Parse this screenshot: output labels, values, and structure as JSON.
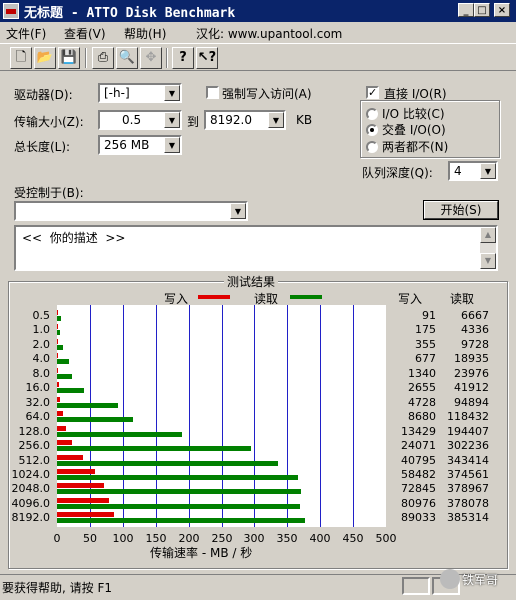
{
  "window": {
    "title": "无标题 - ATTO Disk Benchmark"
  },
  "menu": [
    "文件(F)",
    "查看(V)",
    "帮助(H)",
    "汉化: www.upantool.com"
  ],
  "toolbar": {
    "icons": [
      "new-icon",
      "open-icon",
      "save-icon",
      "print-icon",
      "print-preview-icon",
      "move-icon",
      "help-icon",
      "context-help-icon"
    ]
  },
  "settings": {
    "drive_label": "驱动器(D):",
    "drive_value": "[-h-]",
    "force_write_label": "强制写入访问(A)",
    "transfer_label": "传输大小(Z):",
    "transfer_from": "0.5",
    "to_label": "到",
    "transfer_to": "8192.0",
    "unit": "KB",
    "length_label": "总长度(L):",
    "length_value": "256 MB",
    "direct_io_label": "直接 I/O(R)",
    "direct_io_checked": true,
    "io_compare_label": "I/O 比较(C)",
    "overlap_io_label": "交叠 I/O(O)",
    "neither_label": "两者都不(N)",
    "queue_label": "队列深度(Q):",
    "queue_value": "4",
    "controlled_label": "受控制于(B):",
    "controlled_value": "",
    "start_button": "开始(S)",
    "description": "<<  你的描述  >>"
  },
  "results": {
    "group_title": "测试结果",
    "write_label": "写入",
    "read_label": "读取",
    "col_write": "写入",
    "col_read": "读取",
    "write_color": "#e00000",
    "read_color": "#008000"
  },
  "chart_data": {
    "type": "bar",
    "orientation": "horizontal",
    "xlabel": "传输速率 - MB / 秒",
    "xlim": [
      0,
      500
    ],
    "xticks": [
      0,
      50,
      100,
      150,
      200,
      250,
      300,
      350,
      400,
      450,
      500
    ],
    "categories": [
      "0.5",
      "1.0",
      "2.0",
      "4.0",
      "8.0",
      "16.0",
      "32.0",
      "64.0",
      "128.0",
      "256.0",
      "512.0",
      "1024.0",
      "2048.0",
      "4096.0",
      "8192.0"
    ],
    "series": [
      {
        "name": "写入",
        "values": [
          91,
          175,
          355,
          677,
          1340,
          2655,
          4728,
          8680,
          13429,
          24071,
          40795,
          58482,
          72845,
          80976,
          89033
        ]
      },
      {
        "name": "读取",
        "values": [
          6667,
          4336,
          9728,
          18935,
          23976,
          41912,
          94894,
          118432,
          194407,
          302236,
          343414,
          374561,
          378967,
          378078,
          385314
        ]
      }
    ],
    "value_unit": "KB/s",
    "grid": true
  },
  "status": {
    "text": "要获得帮助, 请按 F1",
    "watermark": "铁军哥"
  }
}
